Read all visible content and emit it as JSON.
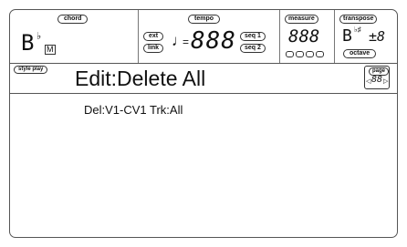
{
  "header": {
    "chord": {
      "label": "chord",
      "symbol": "B",
      "accidental": "♭",
      "indicator": "M"
    },
    "tempo": {
      "label": "tempo",
      "left_tags": [
        "ext",
        "link"
      ],
      "right_tags": [
        "seq 1",
        "seq 2"
      ],
      "note_symbol": "♩",
      "equals": "=",
      "value": "888"
    },
    "measure": {
      "label": "measure",
      "value": "888"
    },
    "transpose": {
      "label": "transpose",
      "symbol": "B",
      "accidentals": "♭♯",
      "value": "±8",
      "sublabel": "octave"
    }
  },
  "title_bar": {
    "mode_label": "style play",
    "title": "Edit:Delete All",
    "page": {
      "label": "page",
      "value": "88"
    }
  },
  "content": {
    "text": "Del:V1-CV1 Trk:All"
  }
}
